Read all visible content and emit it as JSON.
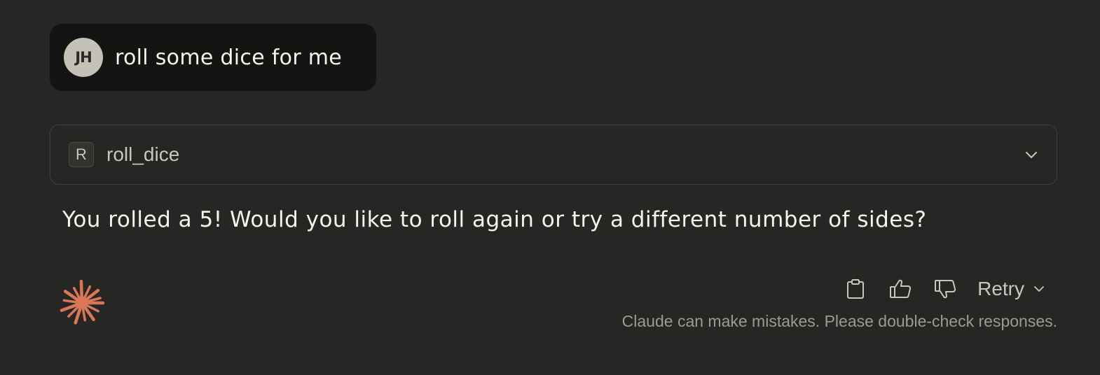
{
  "user_message": {
    "avatar_initials": "JH",
    "text": "roll some dice for me"
  },
  "tool_call": {
    "badge_letter": "R",
    "name": "roll_dice"
  },
  "assistant_message": {
    "text": "You rolled a 5! Would you like to roll again or try a different number of sides?"
  },
  "actions": {
    "copy_icon": "clipboard-icon",
    "thumbs_up_icon": "thumbs-up-icon",
    "thumbs_down_icon": "thumbs-down-icon",
    "retry_label": "Retry"
  },
  "disclaimer": "Claude can make mistakes. Please double-check responses.",
  "colors": {
    "background": "#262624",
    "user_bubble": "#141413",
    "accent": "#d97757",
    "text": "#f5f4ef",
    "muted_text": "#9c9a92"
  }
}
